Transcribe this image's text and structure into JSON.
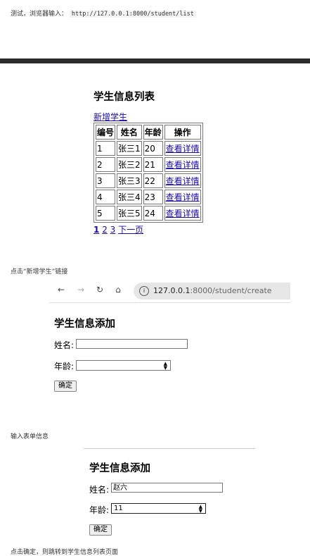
{
  "notes": {
    "test_prefix": "测试，浏览器输入：",
    "test_url": "http://127.0.0.1:8000/student/list",
    "click_add": "点击“新增学生”链接",
    "fill_form": "输入表单信息",
    "submit_tip": "点击确定，则跳转到学生信息列表页面"
  },
  "list_page": {
    "title": "学生信息列表",
    "add_link": "新增学生",
    "columns": [
      "编号",
      "姓名",
      "年龄",
      "操作"
    ],
    "rows": [
      [
        "1",
        "张三1",
        "20",
        "查看详情"
      ],
      [
        "2",
        "张三2",
        "21",
        "查看详情"
      ],
      [
        "3",
        "张三3",
        "22",
        "查看详情"
      ],
      [
        "4",
        "张三4",
        "23",
        "查看详情"
      ],
      [
        "5",
        "张三5",
        "24",
        "查看详情"
      ]
    ],
    "pager": {
      "current": "1",
      "page2": "2",
      "page3": "3",
      "next": "下一页"
    }
  },
  "browser": {
    "url_host": "127.0.0.1",
    "url_rest": ":8000/student/create",
    "icons": [
      "back-icon",
      "forward-icon",
      "reload-icon",
      "home-icon",
      "info-icon"
    ]
  },
  "create_page_empty": {
    "title": "学生信息添加",
    "name_label": "姓名:",
    "age_label": "年龄:",
    "name_value": "",
    "age_value": "",
    "submit_label": "确定"
  },
  "create_page_filled": {
    "title": "学生信息添加",
    "name_label": "姓名:",
    "age_label": "年龄:",
    "name_value": "赵六",
    "age_value": "11",
    "submit_label": "确定"
  }
}
